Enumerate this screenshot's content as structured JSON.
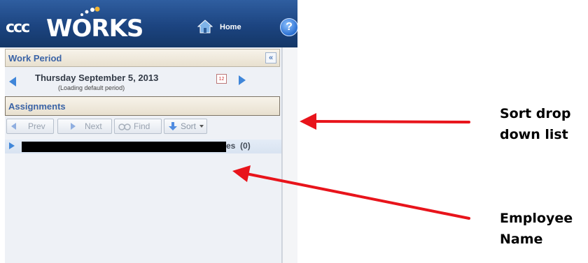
{
  "app": {
    "logo_prefix": "ccc",
    "logo_main": "WORKS",
    "home_label": "Home",
    "help_glyph": "?"
  },
  "work_period": {
    "header": "Work Period",
    "collapse_glyph": "«",
    "date": "Thursday September 5, 2013",
    "status": "(Loading default period)",
    "calendar_glyph": "12"
  },
  "assignments": {
    "header": "Assignments",
    "toolbar": {
      "prev": "Prev",
      "next": "Next",
      "find": "Find",
      "sort": "Sort"
    },
    "employee_suffix": "es",
    "employee_count": "(0)"
  },
  "annotations": {
    "sort_line1": "Sort drop",
    "sort_line2": "down list",
    "employee_line1": "Employee",
    "employee_line2": "Name",
    "arrow_color": "#e8141b"
  },
  "colors": {
    "header_blue": "#1c4480",
    "panel_title": "#3a63a6",
    "accent_arrow": "#3f86d9"
  }
}
